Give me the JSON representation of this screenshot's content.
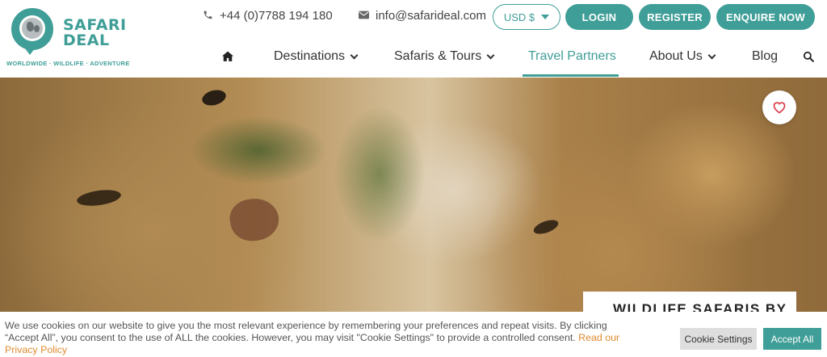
{
  "brand": {
    "name_line1": "SAFARI",
    "name_line2": "DEAL",
    "tagline": "WORLDWIDE · WILDLIFE · ADVENTURE"
  },
  "contact": {
    "phone": "+44 (0)7788 194 180",
    "email": "info@safarideal.com"
  },
  "currency": {
    "selected": "USD $"
  },
  "header_buttons": {
    "login": "LOGIN",
    "register": "REGISTER",
    "enquire": "ENQUIRE NOW"
  },
  "nav": {
    "items": [
      {
        "label": "Destinations",
        "dropdown": true
      },
      {
        "label": "Safaris & Tours",
        "dropdown": true
      },
      {
        "label": "Travel Partners",
        "active": true
      },
      {
        "label": "About Us",
        "dropdown": true
      },
      {
        "label": "Blog"
      }
    ]
  },
  "hero": {
    "card_title": "WILDLIFE SAFARIS BY"
  },
  "cookie": {
    "text": "We use cookies on our website to give you the most relevant experience by remembering your preferences and repeat visits. By clicking “Accept All”, you consent to the use of ALL the cookies. However, you may visit \"Cookie Settings\" to provide a controlled consent. ",
    "link": "Read our Privacy Policy",
    "settings_label": "Cookie Settings",
    "accept_label": "Accept All"
  },
  "colors": {
    "brand": "#3f9e97",
    "link": "#e08a2e"
  },
  "icons": [
    "phone-icon",
    "envelope-icon",
    "home-icon",
    "search-icon",
    "heart-icon",
    "globe-icon"
  ]
}
